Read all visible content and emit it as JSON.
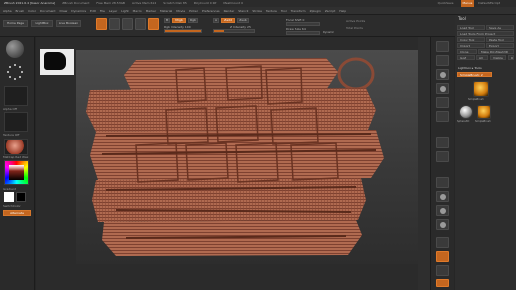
{
  "titlebar": {
    "app": "ZBrush 2021.6.4 [Kasor Anarome]",
    "doc": "ZBrush Document",
    "stats": [
      "Free Mem 28.53GB",
      "Active Mem 612",
      "Scratch Disk 85",
      "PolyCount 0 KP",
      "MeshCount 0"
    ],
    "quicksave": "QuickSave",
    "menus_badge": "Menus",
    "default_script": "DefaultZScript"
  },
  "menubar": {
    "items": [
      "Alpha",
      "Brush",
      "Color",
      "Document",
      "Draw",
      "Dynamics",
      "Edit",
      "File",
      "Layer",
      "Light",
      "Macro",
      "Marker",
      "Material",
      "Movie",
      "Picker",
      "Preferences",
      "Render",
      "Stencil",
      "Stroke",
      "Texture",
      "Tool",
      "Transform",
      "Zplugin",
      "Zscript",
      "Help"
    ]
  },
  "toolbar": {
    "home_page": "Home Page",
    "lightbox": "LightBox",
    "live_boolean": "Live Boolean",
    "mrgb": "Mrgb",
    "rgb": "Rgb",
    "m": "M",
    "rgb_intensity": "Rgb Intensity",
    "rgb_intensity_value": "100",
    "zadd": "Zadd",
    "zsub": "Zsub",
    "zcut": "Zcut",
    "z_intensity": "Z Intensity",
    "z_intensity_value": "25",
    "focal_shift": "Focal Shift",
    "focal_shift_value": "0",
    "draw_size": "Draw Size",
    "draw_size_value": "64",
    "dynamic": "Dynamic",
    "active_points": "Active Points",
    "total_points": "Total Points",
    "rgb_intensity_level": 1.0,
    "z_intensity_level": 0.25
  },
  "leftpanel": {
    "alpha_off": "Alpha Off",
    "texture_off": "Texture Off",
    "material": "MatCap Red Wax",
    "gradient": "Gradient",
    "switch_color": "SwitchColor",
    "alternate": "Alternate",
    "main_color": "#d23b2b"
  },
  "rightpanel": {
    "title": "Tool",
    "rows": [
      "Load Tool",
      "Save As",
      "Load Tools From Project",
      "Copy Tool",
      "Paste Tool",
      "Import",
      "Export",
      "Clone",
      "Make PolyMesh3D",
      "GoZ",
      "All",
      "Visible",
      "R"
    ],
    "lightbox_tools": "Lightbox ▸ Tools",
    "current_tool": "SimpleBrush: 2",
    "thumbs": [
      "SimpleBrush",
      "Sphere3D",
      "SimpleBrush"
    ]
  },
  "colors": {
    "accent": "#c4661f",
    "clay": "#b06a50",
    "panel": "#2d2d2d"
  }
}
